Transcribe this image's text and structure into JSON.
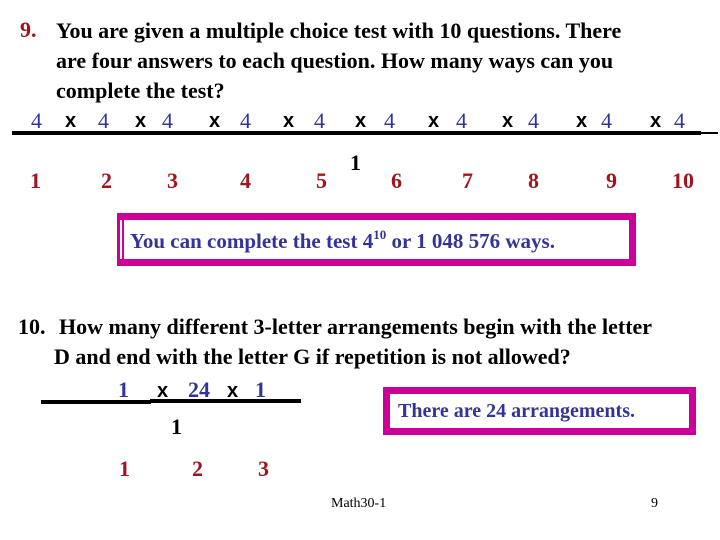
{
  "question9": {
    "number": "9.",
    "lines": [
      "You are given a multiple choice test with 10 questions.  There",
      "are four answers to each question.  How many ways can you",
      "complete the test?"
    ],
    "slot_values": [
      "4",
      "4",
      "4",
      "4",
      "4",
      "4",
      "4",
      "4",
      "4",
      "4"
    ],
    "times_symbol": "x",
    "extra_mark": "1",
    "slot_labels": [
      "1",
      "2",
      "3",
      "4",
      "5",
      "6",
      "7",
      "8",
      "9",
      "10"
    ],
    "answer": {
      "prefix": "You can complete the test 4",
      "exponent": "10",
      "suffix": " or 1 048 576 ways."
    }
  },
  "question10": {
    "number": "10.",
    "lines": [
      "How many different 3-letter arrangements begin with the letter",
      "D and end with the letter G if repetition is not allowed?"
    ],
    "slot_values": [
      "1",
      "24",
      "1"
    ],
    "times_symbol": "x",
    "extra_mark": "1",
    "slot_labels": [
      "1",
      "2",
      "3"
    ],
    "answer": "There are 24 arrangements."
  },
  "footer": {
    "course": "Math30-1",
    "page": "9"
  },
  "colors": {
    "question_number": "#A0141E",
    "answer_blue": "#333399",
    "box_border": "#CC0099"
  }
}
